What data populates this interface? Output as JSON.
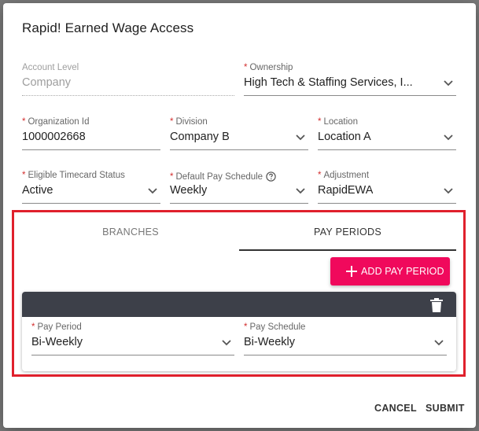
{
  "dialog": {
    "title": "Rapid! Earned Wage Access"
  },
  "form": {
    "account_level": {
      "label": "Account Level",
      "value": "Company"
    },
    "ownership": {
      "required": "*",
      "label": "Ownership",
      "value": "High Tech & Staffing Services, I..."
    },
    "organization_id": {
      "required": "*",
      "label": "Organization Id",
      "value": "1000002668"
    },
    "division": {
      "required": "*",
      "label": "Division",
      "value": "Company B"
    },
    "location": {
      "required": "*",
      "label": "Location",
      "value": "Location A"
    },
    "eligible_timecard_status": {
      "required": "*",
      "label": "Eligible Timecard Status",
      "value": "Active"
    },
    "default_pay_schedule": {
      "required": "*",
      "label": "Default Pay Schedule",
      "value": "Weekly"
    },
    "adjustment": {
      "required": "*",
      "label": "Adjustment",
      "value": "RapidEWA"
    }
  },
  "tabs": [
    {
      "label": "BRANCHES",
      "active": false
    },
    {
      "label": "PAY PERIODS",
      "active": true
    }
  ],
  "pay_periods": {
    "add_button_label": "ADD PAY PERIOD",
    "rows": [
      {
        "pay_period": {
          "required": "*",
          "label": "Pay Period",
          "value": "Bi-Weekly"
        },
        "pay_schedule": {
          "required": "*",
          "label": "Pay Schedule",
          "value": "Bi-Weekly"
        }
      }
    ]
  },
  "footer": {
    "cancel_label": "CANCEL",
    "submit_label": "SUBMIT"
  },
  "icons": {
    "dropdown": "chevron-down-icon",
    "help": "help-circle-icon",
    "add": "plus-icon",
    "delete": "trash-icon"
  },
  "colors": {
    "accent": "#f0095c",
    "highlight_border": "#e0202c",
    "card_header": "#3d4049",
    "required": "#d32f2f"
  }
}
